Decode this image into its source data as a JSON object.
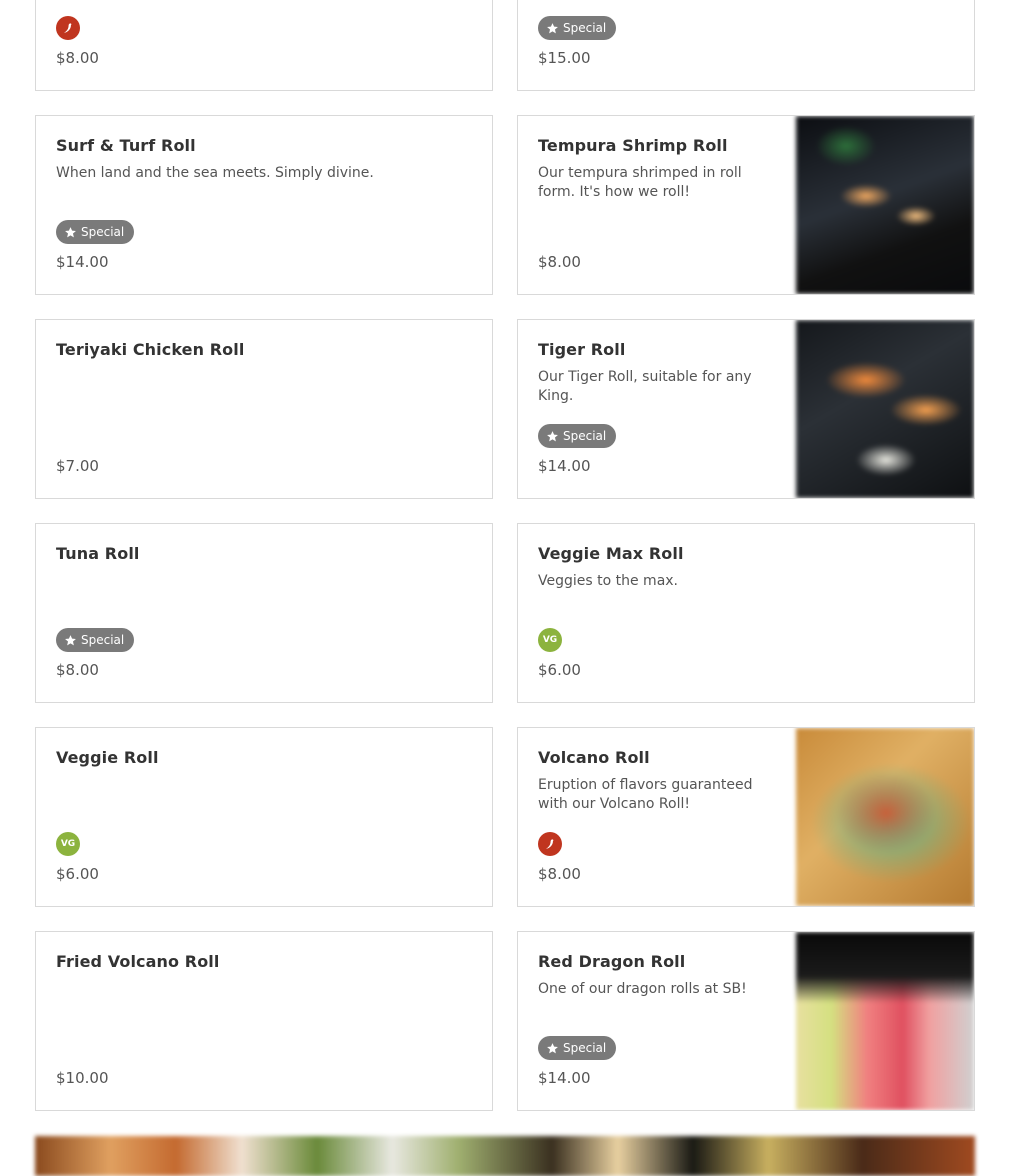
{
  "menu": {
    "items": [
      {
        "name": "",
        "desc": "",
        "price": "$8.00",
        "special": false,
        "spicy": true,
        "vegan": false,
        "image": ""
      },
      {
        "name": "",
        "desc": "",
        "price": "$15.00",
        "special": true,
        "spicy": false,
        "vegan": false,
        "image": ""
      },
      {
        "name": "Surf & Turf Roll",
        "desc": "When land and the sea meets. Simply divine.",
        "price": "$14.00",
        "special": true,
        "spicy": false,
        "vegan": false,
        "image": ""
      },
      {
        "name": "Tempura Shrimp Roll",
        "desc": "Our tempura shrimped in roll form. It's how we roll!",
        "price": "$8.00",
        "special": false,
        "spicy": false,
        "vegan": false,
        "image": "shrimp"
      },
      {
        "name": "Teriyaki Chicken Roll",
        "desc": "",
        "price": "$7.00",
        "special": false,
        "spicy": false,
        "vegan": false,
        "image": ""
      },
      {
        "name": "Tiger Roll",
        "desc": "Our Tiger Roll, suitable for any King.",
        "price": "$14.00",
        "special": true,
        "spicy": false,
        "vegan": false,
        "image": "tiger"
      },
      {
        "name": "Tuna Roll",
        "desc": "",
        "price": "$8.00",
        "special": true,
        "spicy": false,
        "vegan": false,
        "image": ""
      },
      {
        "name": "Veggie Max Roll",
        "desc": "Veggies to the max.",
        "price": "$6.00",
        "special": false,
        "spicy": false,
        "vegan": true,
        "image": ""
      },
      {
        "name": "Veggie Roll",
        "desc": "",
        "price": "$6.00",
        "special": false,
        "spicy": false,
        "vegan": true,
        "image": ""
      },
      {
        "name": "Volcano Roll",
        "desc": "Eruption of flavors guaranteed with our Volcano Roll!",
        "price": "$8.00",
        "special": false,
        "spicy": true,
        "vegan": false,
        "image": "volcano"
      },
      {
        "name": "Fried Volcano Roll",
        "desc": "",
        "price": "$10.00",
        "special": false,
        "spicy": false,
        "vegan": false,
        "image": ""
      },
      {
        "name": "Red Dragon Roll",
        "desc": "One of our dragon rolls at SB!",
        "price": "$14.00",
        "special": true,
        "spicy": false,
        "vegan": false,
        "image": "dragon"
      }
    ]
  },
  "labels": {
    "special": "Special",
    "vegan": "VG"
  },
  "colors": {
    "special_badge": "#7a7a7a",
    "spicy": "#c0351f",
    "vegan": "#8cb33e",
    "card_border": "#d9d9d9"
  },
  "icons": {
    "special": "star-icon",
    "spicy": "chili-pepper-icon",
    "vegan": "vegan-icon"
  }
}
